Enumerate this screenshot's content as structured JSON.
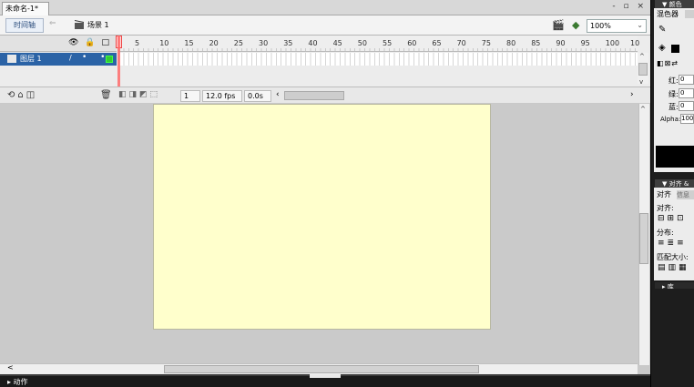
{
  "document": {
    "tab_label": "未命名-1*",
    "window_controls": "- ▫ ×"
  },
  "editbar": {
    "timeline_button": "时间轴",
    "back_arrow": "⇐",
    "scene_label": "场景 1",
    "zoom_value": "100%"
  },
  "timeline": {
    "header_icons": "👁 🔒 □",
    "ruler_ticks": [
      "5",
      "10",
      "15",
      "20",
      "25",
      "30",
      "35",
      "40",
      "45",
      "50",
      "55",
      "60",
      "65",
      "70",
      "75",
      "80",
      "85",
      "90",
      "95",
      "100",
      "10"
    ],
    "layer": {
      "name": "图层 1",
      "dots": "• •"
    },
    "footer": {
      "current_frame": "1",
      "frame_rate": "12.0 fps",
      "elapsed_time": "0.0s",
      "scroll_left": "‹",
      "scroll_right": "›"
    }
  },
  "stage": {
    "fill_color": "#ffffcc",
    "bg_color": "#cacaca"
  },
  "actions_panel": {
    "label": "▸ 动作"
  },
  "color_panel": {
    "title": "▼ 颜色",
    "tab_label": "混色器",
    "red_label": "红:",
    "green_label": "绿:",
    "blue_label": "蓝:",
    "red": "0",
    "green": "0",
    "blue": "0",
    "alpha_label": "Alpha:",
    "alpha": "100"
  },
  "align_panel": {
    "title": "▼ 对齐 &",
    "tab_label": "对齐",
    "info_tab": "信息",
    "align_label": "对齐:",
    "distribute_label": "分布:",
    "match_size_label": "匹配大小:"
  },
  "library_panel": {
    "title": "▸ 库"
  },
  "icons": {
    "scene": "clapper-icon",
    "edit_symbols": "edit-symbols-icon",
    "edit_scene": "edit-scene-icon",
    "trash": "trash-icon"
  }
}
